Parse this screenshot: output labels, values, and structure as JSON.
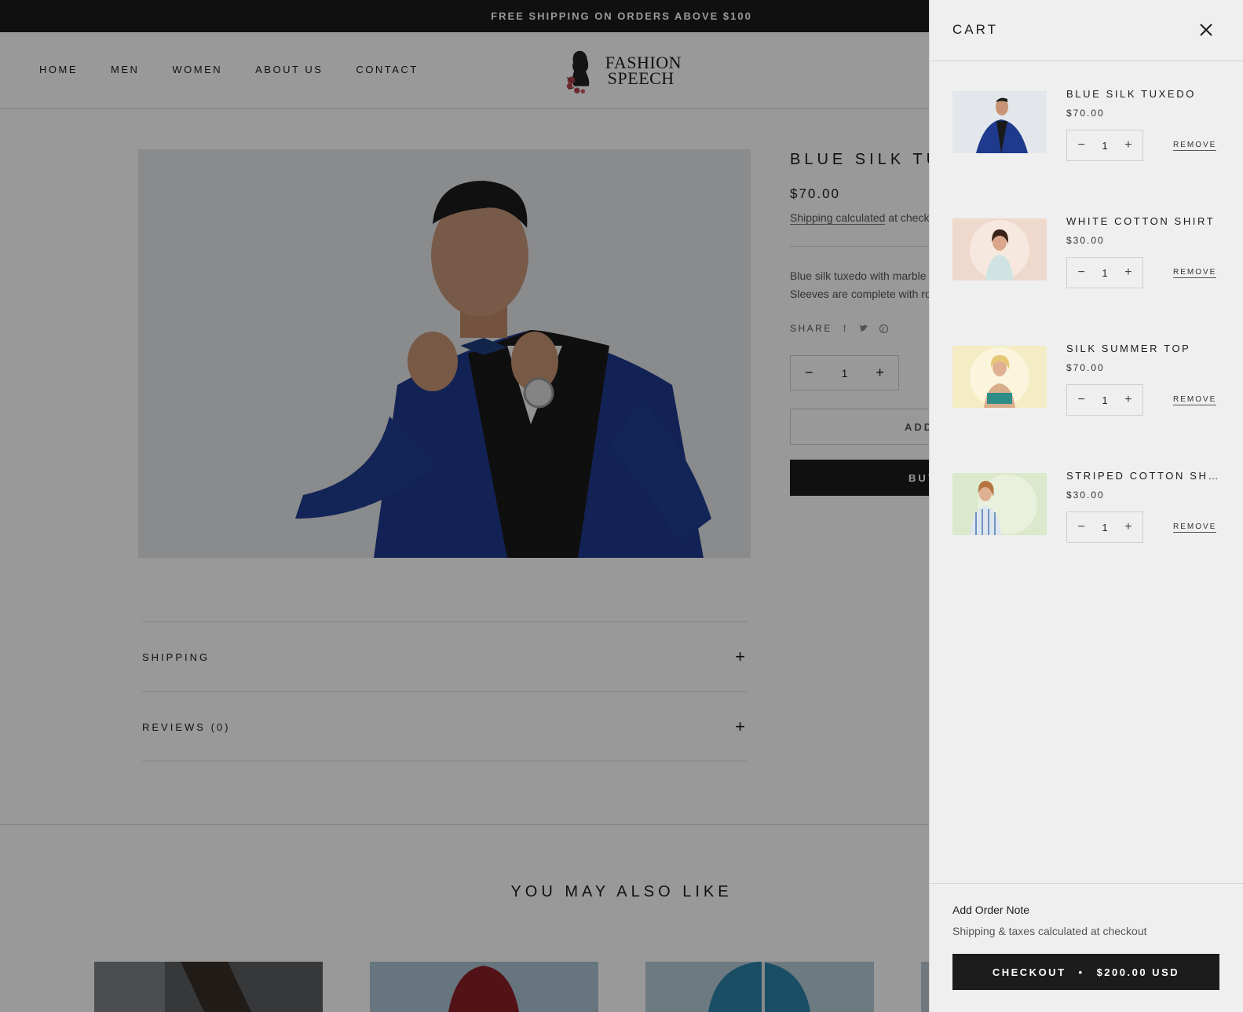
{
  "announcement": "FREE SHIPPING ON ORDERS ABOVE $100",
  "nav": {
    "items": [
      {
        "label": "HOME"
      },
      {
        "label": "MEN"
      },
      {
        "label": "WOMEN"
      },
      {
        "label": "ABOUT US"
      },
      {
        "label": "CONTACT"
      }
    ]
  },
  "logo": {
    "line1": "FASHION",
    "line2": "SPEECH"
  },
  "product": {
    "title": "BLUE SILK TUX",
    "price": "$70.00",
    "shipping_link": "Shipping calculated",
    "shipping_rest": " at check",
    "desc_line1": "Blue silk tuxedo with marble",
    "desc_line2": "Sleeves are complete with ro",
    "share_label": "SHARE",
    "quantity": "1",
    "add_label": "ADD",
    "buy_label": "BUY"
  },
  "accordion": [
    {
      "label": "SHIPPING"
    },
    {
      "label": "REVIEWS (0)"
    }
  ],
  "also_like_title": "YOU MAY ALSO LIKE",
  "cart": {
    "title": "CART",
    "items": [
      {
        "name": "BLUE SILK TUXEDO",
        "price": "$70.00",
        "qty": "1",
        "remove": "REMOVE"
      },
      {
        "name": "WHITE COTTON SHIRT",
        "price": "$30.00",
        "qty": "1",
        "remove": "REMOVE"
      },
      {
        "name": "SILK SUMMER TOP",
        "price": "$70.00",
        "qty": "1",
        "remove": "REMOVE"
      },
      {
        "name": "STRIPED COTTON SHI…",
        "price": "$30.00",
        "qty": "1",
        "remove": "REMOVE"
      }
    ],
    "note_label": "Add Order Note",
    "taxes_label": "Shipping & taxes calculated at checkout",
    "checkout_label": "CHECKOUT",
    "checkout_total": "$200.00 USD"
  },
  "colors": {
    "accent": "#1c1c1c",
    "drawer_bg": "#efefef",
    "overlay": "rgba(0,0,0,0.40)"
  }
}
